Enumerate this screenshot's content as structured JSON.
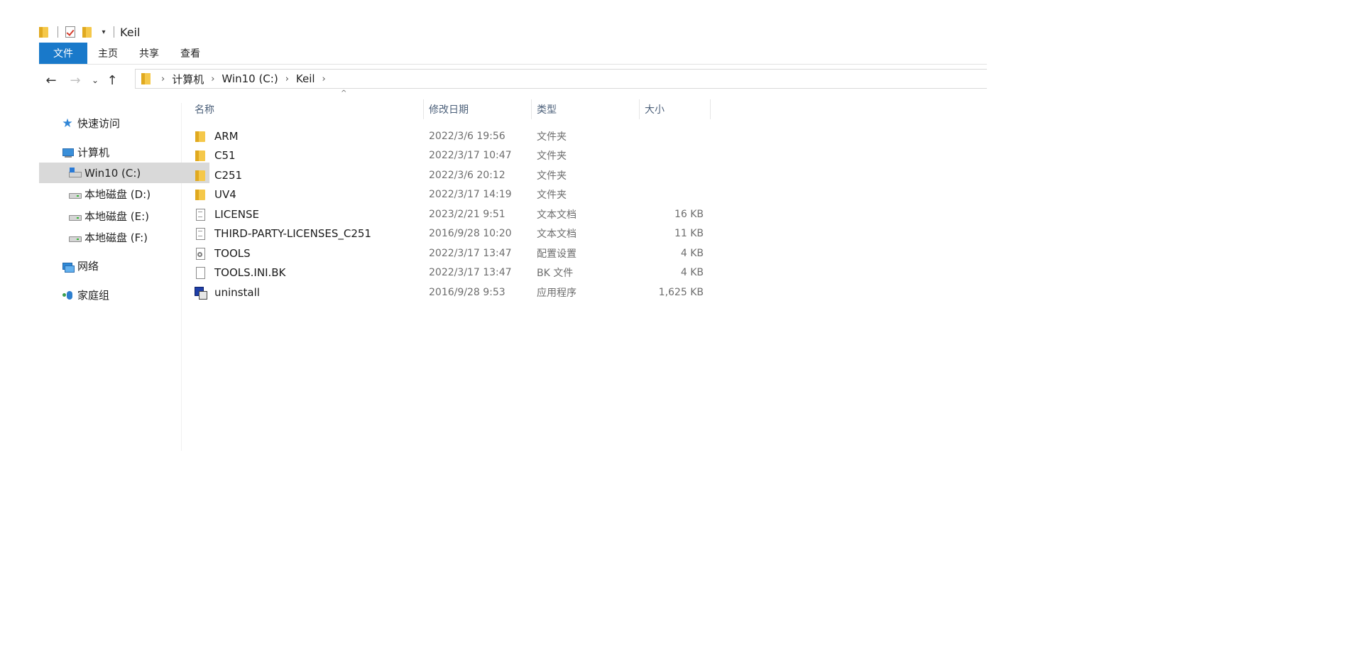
{
  "window": {
    "title": "Keil"
  },
  "ribbon": {
    "tabs": [
      "文件",
      "主页",
      "共享",
      "查看"
    ]
  },
  "address": {
    "crumbs": [
      "计算机",
      "Win10 (C:)",
      "Keil"
    ]
  },
  "sidebar": {
    "items": [
      {
        "label": "快速访问",
        "icon": "star-icon"
      },
      {
        "label": "计算机",
        "icon": "computer-icon"
      },
      {
        "label": "Win10 (C:)",
        "icon": "windows-drive-icon",
        "selected": true
      },
      {
        "label": "本地磁盘 (D:)",
        "icon": "drive-icon"
      },
      {
        "label": "本地磁盘 (E:)",
        "icon": "drive-icon"
      },
      {
        "label": "本地磁盘 (F:)",
        "icon": "drive-icon"
      },
      {
        "label": "网络",
        "icon": "network-icon"
      },
      {
        "label": "家庭组",
        "icon": "homegroup-icon"
      }
    ]
  },
  "columns": {
    "name": "名称",
    "date": "修改日期",
    "type": "类型",
    "size": "大小"
  },
  "files": [
    {
      "name": "ARM",
      "date": "2022/3/6 19:56",
      "type": "文件夹",
      "size": "",
      "icon": "folder-icon"
    },
    {
      "name": "C51",
      "date": "2022/3/17 10:47",
      "type": "文件夹",
      "size": "",
      "icon": "folder-icon"
    },
    {
      "name": "C251",
      "date": "2022/3/6 20:12",
      "type": "文件夹",
      "size": "",
      "icon": "folder-icon"
    },
    {
      "name": "UV4",
      "date": "2022/3/17 14:19",
      "type": "文件夹",
      "size": "",
      "icon": "folder-icon"
    },
    {
      "name": "LICENSE",
      "date": "2023/2/21 9:51",
      "type": "文本文档",
      "size": "16 KB",
      "icon": "text-document-icon"
    },
    {
      "name": "THIRD-PARTY-LICENSES_C251",
      "date": "2016/9/28 10:20",
      "type": "文本文档",
      "size": "11 KB",
      "icon": "text-document-icon"
    },
    {
      "name": "TOOLS",
      "date": "2022/3/17 13:47",
      "type": "配置设置",
      "size": "4 KB",
      "icon": "settings-file-icon"
    },
    {
      "name": "TOOLS.INI.BK",
      "date": "2022/3/17 13:47",
      "type": "BK 文件",
      "size": "4 KB",
      "icon": "blank-file-icon"
    },
    {
      "name": "uninstall",
      "date": "2016/9/28 9:53",
      "type": "应用程序",
      "size": "1,625 KB",
      "icon": "application-icon"
    }
  ]
}
